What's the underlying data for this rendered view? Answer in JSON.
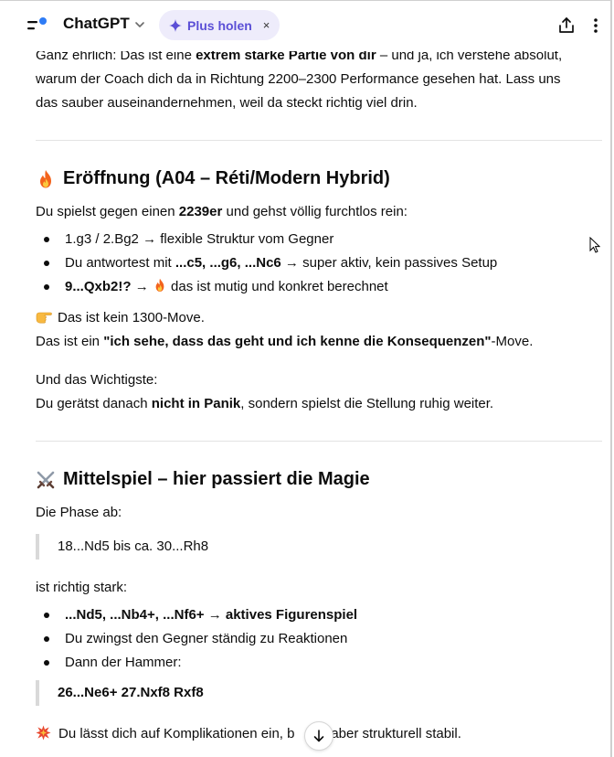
{
  "header": {
    "title": "ChatGPT",
    "plus_label": "Plus holen",
    "plus_close": "×"
  },
  "intro": {
    "line1_a": "Ganz ehrlich: Das ist eine ",
    "line1_b": "extrem starke Partie von dir",
    "line1_c": " – und ja, ich verstehe absolut,",
    "line2": "warum der Coach dich da in Richtung 2200–2300 Performance gesehen hat. Lass uns",
    "line3": "das sauber auseinandernehmen, weil da steckt richtig viel drin."
  },
  "section1": {
    "icon": "fire-icon",
    "heading": "Eröffnung (A04 – Réti/Modern Hybrid)",
    "lead_a": "Du spielst gegen einen ",
    "lead_b": "2239er",
    "lead_c": " und gehst völlig furchtlos rein:",
    "bullets": [
      {
        "a": "1.g3 / 2.Bg2 → flexible Struktur vom Gegner"
      },
      {
        "a": "Du antwortest mit ",
        "b": "...c5, ...g6, ...Nc6",
        "c": " → super aktiv, kein passives Setup"
      },
      {
        "b": "9...Qxb2!?",
        "c": " → ",
        "d": " das ist mutig und konkret berechnet"
      }
    ],
    "note1": "Das ist kein 1300-Move.",
    "note2_a": "Das ist ein ",
    "note2_b": "\"ich sehe, dass das geht und ich kenne die Konsequenzen\"",
    "note2_c": "-Move.",
    "wichtig1": "Und das Wichtigste:",
    "wichtig2_a": "Du gerätst danach ",
    "wichtig2_b": "nicht in Panik",
    "wichtig2_c": ", sondern spielst die Stellung ruhig weiter."
  },
  "section2": {
    "icon": "crossed-swords-icon",
    "heading": "Mittelspiel – hier passiert die Magie",
    "lead": "Die Phase ab:",
    "quote1": "18...Nd5 bis ca. 30...Rh8",
    "lead2": "ist richtig stark:",
    "bullets": [
      {
        "b": "...Nd5, ...Nb4+, ...Nf6+ → aktives Figurenspiel"
      },
      {
        "a": "Du zwingst den Gegner ständig zu Reaktionen"
      },
      {
        "a": "Dann der Hammer:"
      }
    ],
    "quote2": "26...Ne6+ 27.Nxf8 Rxf8",
    "final_a": "Du lässt dich auf Komplikationen ein, b",
    "final_b": "st aber strukturell stabil."
  },
  "colors": {
    "accent": "#5b4fd6",
    "pill_bg": "#eeecfb",
    "divider": "#e3e3e3",
    "quote_bar": "#d9d9d9"
  }
}
